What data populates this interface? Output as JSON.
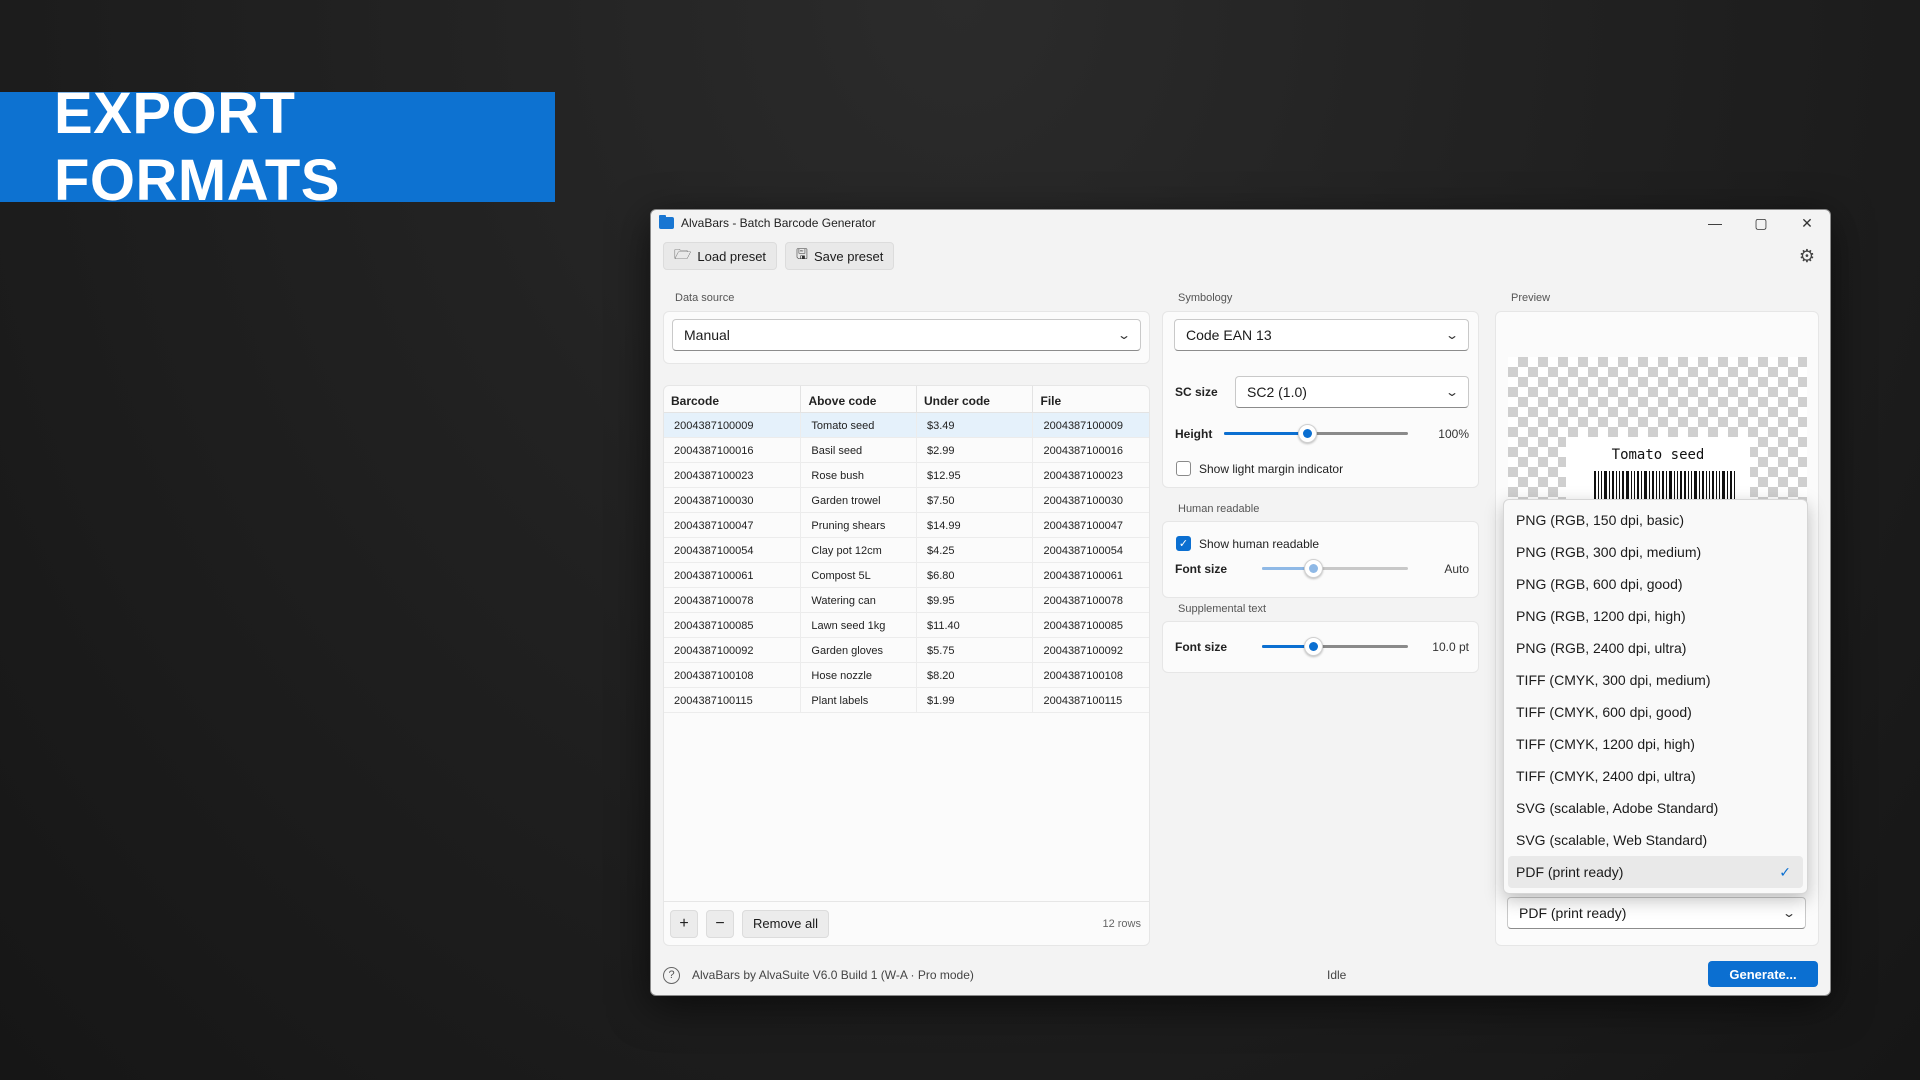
{
  "banner": {
    "text": "EXPORT FORMATS"
  },
  "window": {
    "title": "AlvaBars - Batch Barcode Generator",
    "minimize": "—",
    "maximize": "▢",
    "close": "✕"
  },
  "toolbar": {
    "load_preset": "Load preset",
    "save_preset": "Save preset"
  },
  "data_source": {
    "label": "Data source",
    "selected": "Manual"
  },
  "table": {
    "columns": [
      "Barcode",
      "Above code",
      "Under code",
      "File"
    ],
    "rows": [
      [
        "2004387100009",
        "Tomato seed",
        "$3.49",
        "2004387100009"
      ],
      [
        "2004387100016",
        "Basil seed",
        "$2.99",
        "2004387100016"
      ],
      [
        "2004387100023",
        "Rose bush",
        "$12.95",
        "2004387100023"
      ],
      [
        "2004387100030",
        "Garden trowel",
        "$7.50",
        "2004387100030"
      ],
      [
        "2004387100047",
        "Pruning shears",
        "$14.99",
        "2004387100047"
      ],
      [
        "2004387100054",
        "Clay pot 12cm",
        "$4.25",
        "2004387100054"
      ],
      [
        "2004387100061",
        "Compost 5L",
        "$6.80",
        "2004387100061"
      ],
      [
        "2004387100078",
        "Watering can",
        "$9.95",
        "2004387100078"
      ],
      [
        "2004387100085",
        "Lawn seed 1kg",
        "$11.40",
        "2004387100085"
      ],
      [
        "2004387100092",
        "Garden gloves",
        "$5.75",
        "2004387100092"
      ],
      [
        "2004387100108",
        "Hose nozzle",
        "$8.20",
        "2004387100108"
      ],
      [
        "2004387100115",
        "Plant labels",
        "$1.99",
        "2004387100115"
      ]
    ],
    "add_label": "+",
    "remove_label": "−",
    "remove_all": "Remove all",
    "row_count": "12 rows"
  },
  "symbology": {
    "label": "Symbology",
    "selected": "Code EAN 13",
    "sc_size_label": "SC size",
    "sc_size_value": "SC2 (1.0)",
    "height_label": "Height",
    "height_value": "100%",
    "height_level": 0.45,
    "light_margin_label": "Show light margin indicator"
  },
  "human_readable": {
    "label": "Human readable",
    "show_label": "Show human readable",
    "font_size_label": "Font size",
    "font_size_value": "Auto",
    "font_size_level": 0.35
  },
  "supplemental": {
    "label": "Supplemental text",
    "font_size_label": "Font size",
    "font_size_value": "10.0 pt",
    "font_size_level": 0.35
  },
  "preview": {
    "label": "Preview",
    "barcode_text": "Tomato seed"
  },
  "export_format": {
    "options": [
      "PNG (RGB, 150 dpi, basic)",
      "PNG (RGB, 300 dpi, medium)",
      "PNG (RGB, 600 dpi, good)",
      "PNG (RGB, 1200 dpi, high)",
      "PNG (RGB, 2400 dpi, ultra)",
      "TIFF (CMYK, 300 dpi, medium)",
      "TIFF (CMYK, 600 dpi, good)",
      "TIFF (CMYK, 1200 dpi, high)",
      "TIFF (CMYK, 2400 dpi, ultra)",
      "SVG (scalable, Adobe Standard)",
      "SVG (scalable, Web Standard)",
      "PDF (print ready)"
    ],
    "selected": "PDF (print ready)",
    "check": "✓"
  },
  "status": {
    "help": "?",
    "app_info": "AlvaBars by AlvaSuite V6.0 Build 1 (W-A · Pro mode)",
    "state": "Idle",
    "generate": "Generate..."
  },
  "colors": {
    "accent": "#0b6fd1",
    "banner": "#0d72d1"
  }
}
